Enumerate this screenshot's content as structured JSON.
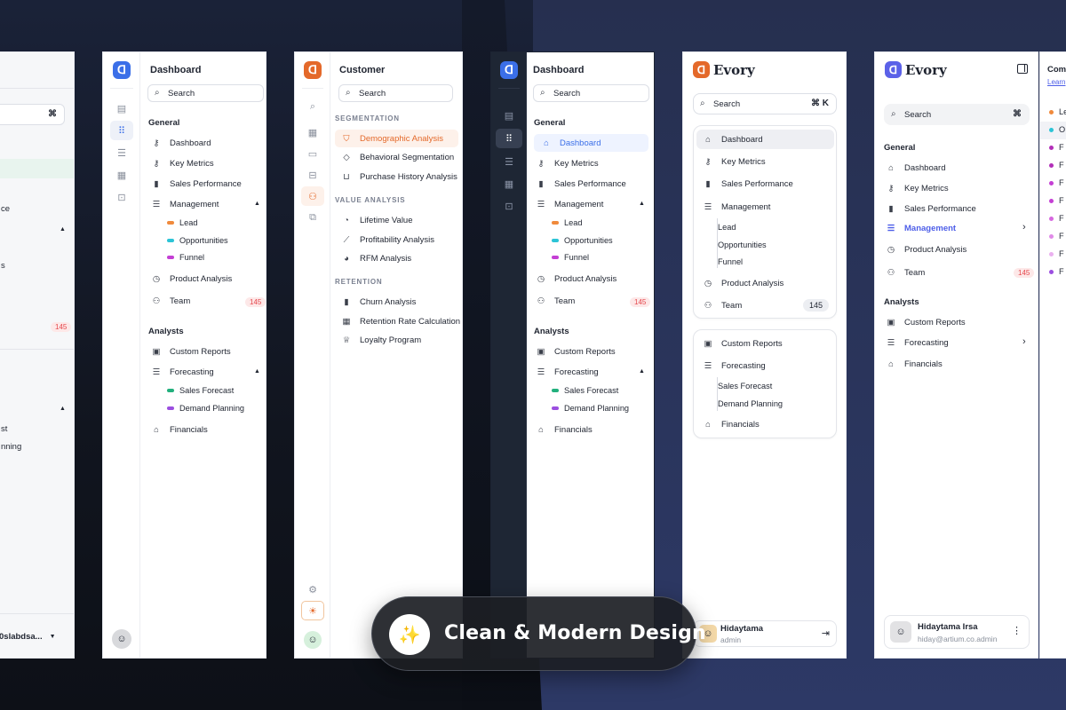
{
  "p1": {
    "cmd": "⌘",
    "item_a": "ce",
    "item_b": "s",
    "badge": "145",
    "sub_a": "st",
    "sub_b": "nning",
    "user": "0slabdsa..."
  },
  "p2": {
    "title": "Dashboard",
    "search_placeholder": "Search",
    "general": "General",
    "items": [
      "Dashboard",
      "Key Metrics",
      "Sales Performance",
      "Management"
    ],
    "management_sub": [
      "Lead",
      "Opportunities",
      "Funnel"
    ],
    "product": "Product Analysis",
    "team": "Team",
    "team_badge": "145",
    "analysts": "Analysts",
    "custom_reports": "Custom Reports",
    "forecasting": "Forecasting",
    "forecast_sub": [
      "Sales Forecast",
      "Demand Planning"
    ],
    "financials": "Financials"
  },
  "p3": {
    "title": "Customer",
    "search_placeholder": "Search",
    "seg_label": "SEGMENTATION",
    "seg_items": [
      "Demographic Analysis",
      "Behavioral Segmentation",
      "Purchase History Analysis"
    ],
    "value_label": "VALUE ANALYSIS",
    "value_items": [
      "Lifetime Value",
      "Profitability Analysis",
      "RFM Analysis"
    ],
    "ret_label": "RETENTION",
    "ret_items": [
      "Churn Analysis",
      "Retention Rate Calculation",
      "Loyalty Program"
    ]
  },
  "p4": {
    "title": "Dashboard",
    "search_placeholder": "Search",
    "general": "General",
    "items": [
      "Dashboard",
      "Key Metrics",
      "Sales Performance",
      "Management"
    ],
    "management_sub": [
      "Lead",
      "Opportunities",
      "Funnel"
    ],
    "product": "Product Analysis",
    "team": "Team",
    "team_badge": "145",
    "analysts": "Analysts",
    "custom_reports": "Custom Reports",
    "forecasting": "Forecasting",
    "forecast_sub": [
      "Sales Forecast",
      "Demand Planning"
    ],
    "financials": "Financials"
  },
  "p5": {
    "brand": "Evory",
    "search_placeholder": "Search",
    "kbd": "⌘ K",
    "items": [
      "Dashboard",
      "Key Metrics",
      "Sales Performance",
      "Management"
    ],
    "management_sub": [
      "Lead",
      "Opportunities",
      "Funnel"
    ],
    "product": "Product Analysis",
    "team": "Team",
    "team_badge": "145",
    "custom_reports": "Custom Reports",
    "forecasting": "Forecasting",
    "forecast_sub": [
      "Sales Forecast",
      "Demand Planning"
    ],
    "financials": "Financials",
    "user_name": "Hidaytama",
    "user_role": "admin"
  },
  "p6": {
    "brand": "Evory",
    "search_placeholder": "Search",
    "kbd": "⌘",
    "general": "General",
    "items": [
      "Dashboard",
      "Key Metrics",
      "Sales Performance",
      "Management",
      "Product Analysis",
      "Team"
    ],
    "team_badge": "145",
    "analysts": "Analysts",
    "analyst_items": [
      "Custom Reports",
      "Forecasting",
      "Financials"
    ],
    "user_name": "Hidaytama Irsa",
    "user_email": "hiday@artium.co.admin"
  },
  "p7": {
    "title": "Com",
    "link": "Learn",
    "rows": [
      "Le",
      "O",
      "F",
      "F",
      "F",
      "F",
      "F",
      "F",
      "F",
      "F"
    ]
  },
  "promo": {
    "label": "Clean & Modern Design"
  },
  "colors": {
    "blue_accent": "#3b6fe8",
    "orange_accent": "#e4692a",
    "violet_accent": "#4d5ee8",
    "badge_red": "#e5484d"
  }
}
